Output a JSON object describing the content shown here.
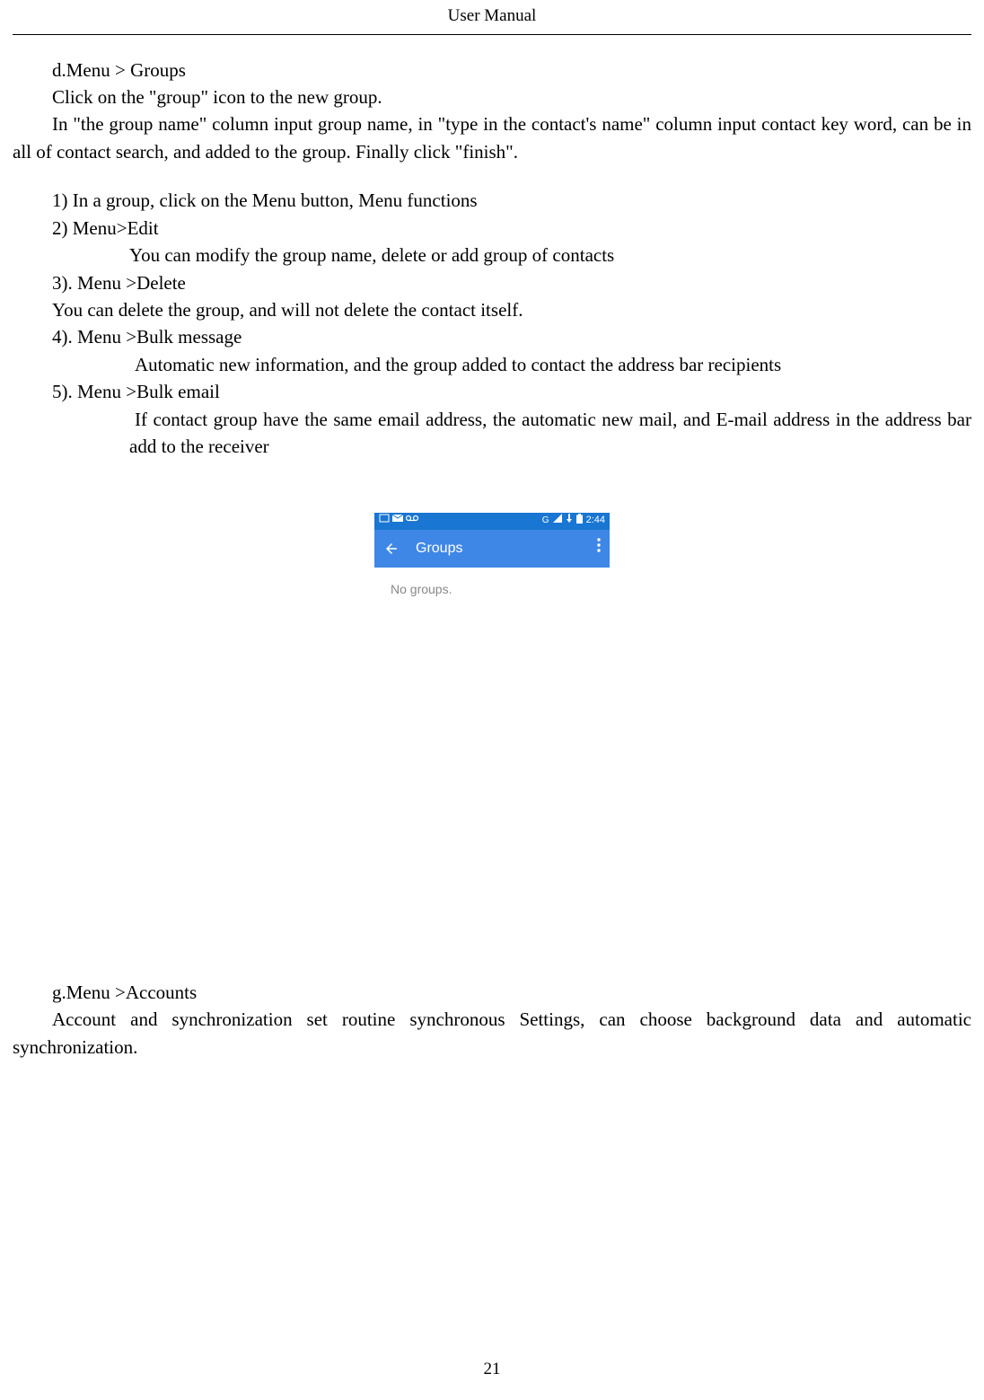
{
  "header": {
    "title": "User    Manual"
  },
  "section_d": {
    "title": "d.Menu > Groups",
    "line1": "Click on the \"group\" icon to the new group.",
    "line2": "In \"the group name\" column input group name, in \"type in the contact's name\" column input contact key word, can be in all of contact search, and added to the group. Finally click \"finish\"."
  },
  "list": {
    "item1": "1)    In a group, click on the Menu button,    Menu functions",
    "item2": "2)    Menu>Edit",
    "item2_sub": "You can modify the group name, delete or add group of contacts",
    "item3": "3).    Menu >Delete",
    "item3_sub": "You can delete the group, and will not delete the contact itself.",
    "item4": "4).    Menu >Bulk message",
    "item4_sub": "Automatic new information, and the group added to contact the address bar recipients",
    "item5": "5).    Menu >Bulk email",
    "item5_sub": "If contact group have the same email address, the automatic new mail, and E-mail address in the address bar add to the receiver"
  },
  "phone": {
    "status": {
      "time": "2:44",
      "network": "G"
    },
    "app_title": "Groups",
    "empty_text": "No groups."
  },
  "section_g": {
    "title": "g.Menu >Accounts",
    "body": "Account and synchronization set routine synchronous Settings, can choose background data and automatic synchronization."
  },
  "page_number": "21"
}
